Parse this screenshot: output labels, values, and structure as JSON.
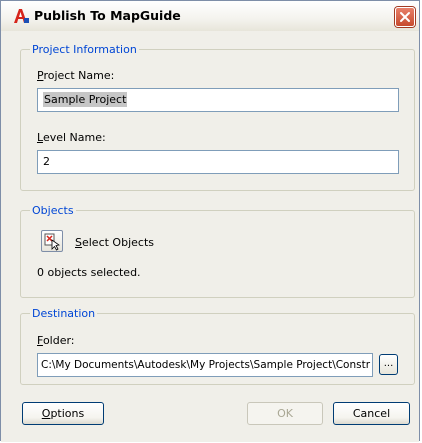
{
  "window": {
    "title": "Publish To MapGuide",
    "app_icon": "autocad-a-icon",
    "close_icon": "close-x-icon"
  },
  "project_info": {
    "legend": "Project Information",
    "project_name_label_key": "P",
    "project_name_label_rest": "roject Name:",
    "project_name_value": "Sample Project",
    "level_name_label_key": "L",
    "level_name_label_rest": "evel Name:",
    "level_name_value": "2"
  },
  "objects": {
    "legend": "Objects",
    "select_label_key": "S",
    "select_label_rest": "elect Objects",
    "status": "0 objects selected."
  },
  "destination": {
    "legend": "Destination",
    "folder_label_key": "F",
    "folder_label_rest": "older:",
    "folder_value": "C:\\My Documents\\Autodesk\\My Projects\\Sample Project\\Constr",
    "browse_label": "..."
  },
  "buttons": {
    "options_key": "O",
    "options_rest": "ptions",
    "ok": "OK",
    "cancel": "Cancel"
  },
  "colors": {
    "legend_blue": "#0046d5",
    "close_red": "#c64a2e",
    "dialog_bg": "#f0efe9"
  }
}
